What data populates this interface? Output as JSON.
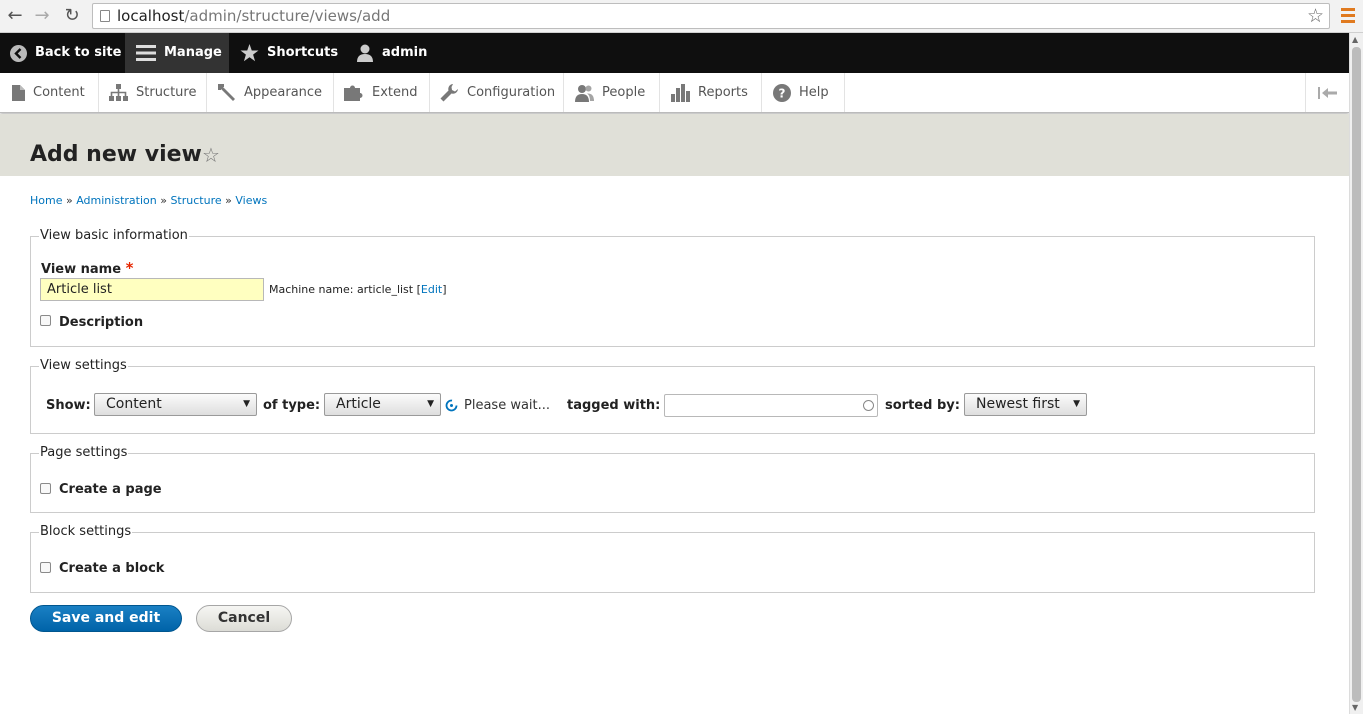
{
  "browser": {
    "url_host": "localhost",
    "url_path": "/admin/structure/views/add"
  },
  "toolbar": {
    "back": "Back to site",
    "manage": "Manage",
    "shortcuts": "Shortcuts",
    "user": "admin"
  },
  "admin_menu": {
    "items": [
      "Content",
      "Structure",
      "Appearance",
      "Extend",
      "Configuration",
      "People",
      "Reports",
      "Help"
    ]
  },
  "page": {
    "title": "Add new view"
  },
  "breadcrumb": {
    "items": [
      "Home",
      "Administration",
      "Structure",
      "Views"
    ],
    "separator": "»"
  },
  "basic_info": {
    "legend": "View basic information",
    "name_label": "View name",
    "required_mark": "*",
    "name_value": "Article list",
    "machine_prefix": "Machine name: article_list [",
    "machine_edit": "Edit",
    "machine_suffix": "]",
    "description_label": "Description",
    "description_checked": false
  },
  "view_settings": {
    "legend": "View settings",
    "show_label": "Show:",
    "show_value": "Content",
    "type_label": "of type:",
    "type_value": "Article",
    "wait_text": "Please wait...",
    "tagged_label": "tagged with:",
    "tagged_value": "",
    "sorted_label": "sorted by:",
    "sorted_value": "Newest first"
  },
  "page_settings": {
    "legend": "Page settings",
    "create_label": "Create a page",
    "checked": false
  },
  "block_settings": {
    "legend": "Block settings",
    "create_label": "Create a block",
    "checked": false
  },
  "actions": {
    "save": "Save and edit",
    "cancel": "Cancel"
  },
  "colors": {
    "toolbar_bg": "#0f0f0f",
    "link": "#0074bd",
    "primary_button": "#0071b8",
    "required": "#e62600",
    "name_input_bg": "#ffffc0",
    "page_header_bg": "#e0e0d8"
  }
}
